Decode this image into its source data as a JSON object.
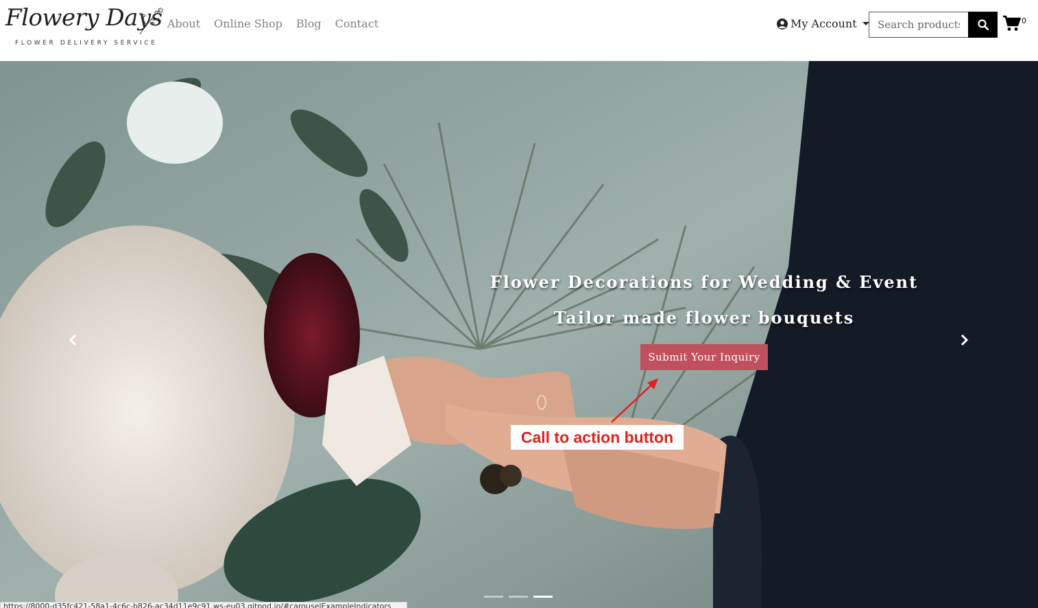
{
  "brand": {
    "name": "Flowery Days",
    "tagline": "FLOWER DELIVERY SERVICE"
  },
  "nav": {
    "items": [
      {
        "label": "About"
      },
      {
        "label": "Online Shop"
      },
      {
        "label": "Blog"
      },
      {
        "label": "Contact"
      }
    ]
  },
  "account": {
    "label": "My Account",
    "icon": "user-circle-icon"
  },
  "search": {
    "placeholder": "Search products",
    "icon": "search-icon"
  },
  "cart": {
    "icon": "shopping-cart-icon",
    "count": "0"
  },
  "hero": {
    "heading": "Flower Decorations for Wedding & Event",
    "subheading": "Tailor made flower bouquets",
    "cta_label": "Submit Your Inquiry",
    "cta_color": "#c0505e",
    "active_slide": 3,
    "slide_count": 3
  },
  "annotation": {
    "text": "Call to action button",
    "color": "#e0201b"
  },
  "status_bar": {
    "url": "https://8000-d35fc421-58a1-4c6c-b826-ac34d11e9c91.ws-eu03.gitpod.io/#carouselExampleIndicators"
  }
}
